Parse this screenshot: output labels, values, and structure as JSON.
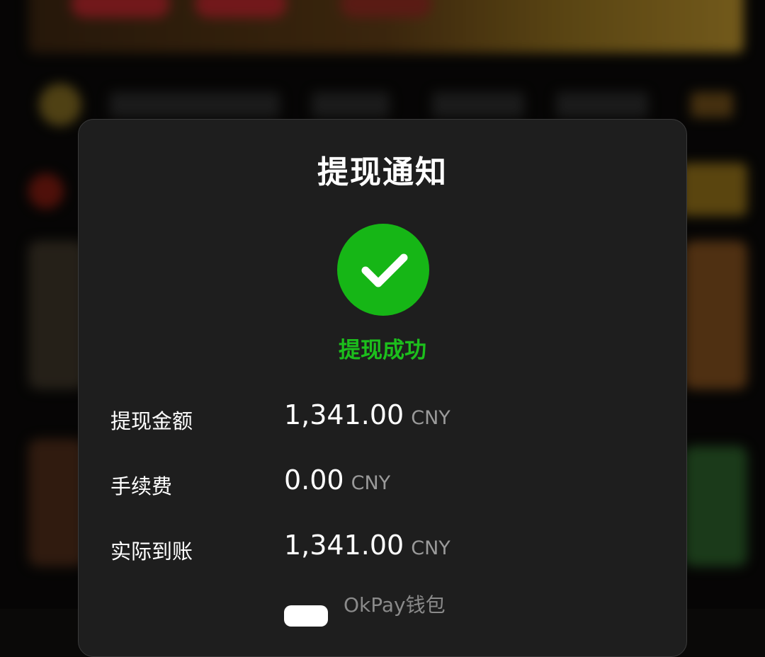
{
  "modal": {
    "title": "提现通知",
    "status_text": "提现成功",
    "rows": [
      {
        "label": "提现金额",
        "value": "1,341.00",
        "unit": "CNY"
      },
      {
        "label": "手续费",
        "value": "0.00",
        "unit": "CNY"
      },
      {
        "label": "实际到账",
        "value": "1,341.00",
        "unit": "CNY"
      }
    ],
    "wallet_name": "OkPay钱包"
  },
  "colors": {
    "success": "#16b616",
    "modal_bg": "#1e1e1e"
  },
  "icons": [
    "checkmark-icon",
    "wallet-icon"
  ]
}
